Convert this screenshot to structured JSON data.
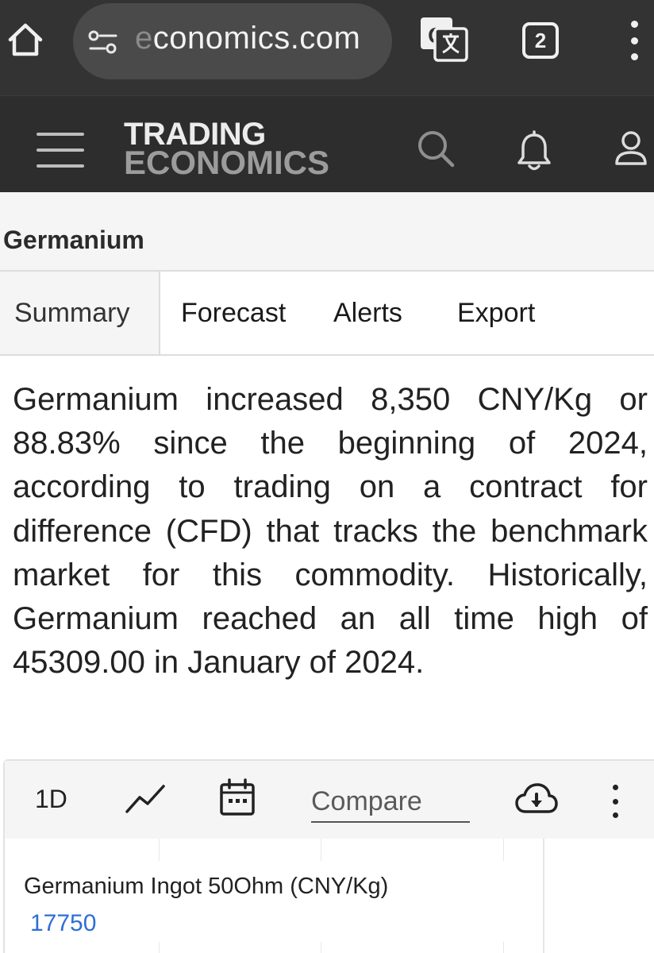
{
  "browser": {
    "url_fragment": "conomics.com",
    "url_faded_char": "e",
    "tab_count": "2"
  },
  "header": {
    "logo_line1": "TRADING",
    "logo_line2": "ECONOMICS"
  },
  "page": {
    "title": "Germanium"
  },
  "tabs": [
    {
      "label": "Summary",
      "active": true
    },
    {
      "label": "Forecast",
      "active": false
    },
    {
      "label": "Alerts",
      "active": false
    },
    {
      "label": "Export",
      "active": false
    }
  ],
  "description": "Germanium increased 8,350 CNY/Kg or 88.83% since the beginning of 2024, according to trading on a contract for difference (CFD) that tracks the benchmark market for this commodity. Historically, Germanium reached an all time high of 45309.00 in January of 2024.",
  "chart_toolbar": {
    "period": "1D",
    "compare_placeholder": "Compare"
  },
  "chart": {
    "series_name": "Germanium Ingot 50Ohm (CNY/Kg)",
    "price": "17750"
  },
  "colors": {
    "browser_bar": "#333333",
    "site_header": "#2d2d2d",
    "price_blue": "#2d6fd6"
  }
}
